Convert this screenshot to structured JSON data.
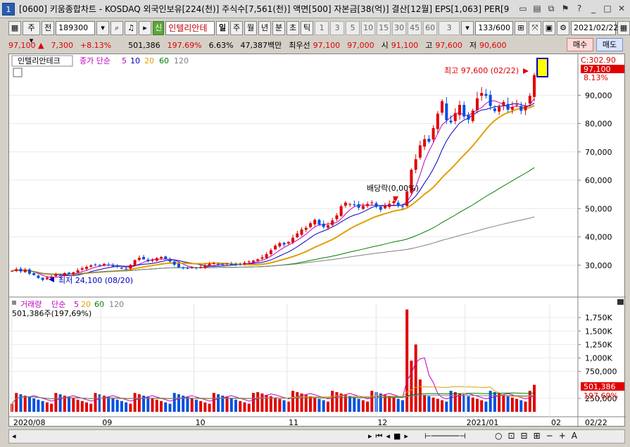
{
  "window": {
    "number": "1",
    "title": "[0600] 키움종합차트 - KOSDAQ 외국인보유[224(천)] 주식수[7,561(천)] 액면[500] 자본금[38(억)] 결산[12월] EPS[1,063] PER[9"
  },
  "toolbar": {
    "period_select": "주",
    "prev_label": "전",
    "code": "189300",
    "sin_badge": "신",
    "stock_name": "인텔리안테",
    "period_tabs": [
      "일",
      "주",
      "월",
      "년",
      "분",
      "초",
      "틱"
    ],
    "active_tab": "일",
    "minute_options": [
      "1",
      "3",
      "5",
      "10",
      "15",
      "30",
      "45",
      "60"
    ],
    "spin_value": "3",
    "count": "133/600",
    "date": "2021/02/22"
  },
  "quote": {
    "price": "97,100",
    "change": "7,300",
    "change_pct": "+8.13%",
    "volume": "501,386",
    "volume_ratio": "197.69%",
    "turnover": "6.63%",
    "amount": "47,387백만",
    "best_label": "최우선",
    "ask": "97,100",
    "bid": "97,000",
    "open_label": "시",
    "open": "91,100",
    "high_label": "고",
    "high": "97,600",
    "low_label": "저",
    "low": "90,600",
    "buy_label": "매수",
    "sell_label": "매도"
  },
  "price_panel": {
    "stock_tag": "인텔리안테크",
    "legend_prefix": "종가 단순",
    "ma": [
      "5",
      "10",
      "20",
      "60",
      "120"
    ],
    "high_annot": "최고 97,600 (02/22)",
    "low_annot": "최저 24,100 (08/20)",
    "dividend_annot": "배당락(0,00%)",
    "axis_top": "C:302.90",
    "axis_price": "97,100",
    "axis_pct": "8.13%",
    "yticks": [
      "90,000",
      "80,000",
      "70,000",
      "60,000",
      "50,000",
      "40,000",
      "30,000"
    ]
  },
  "volume_panel": {
    "legend_title": "거래량",
    "legend_prefix": "단순",
    "ma": [
      "5",
      "20",
      "60",
      "120"
    ],
    "last_value": "501,386주(197,69%)",
    "axis_value": "501,386",
    "axis_pct": "197,69%",
    "yticks": [
      "1,750K",
      "1,500K",
      "1,250K",
      "1,000K",
      "750,000",
      "250,000"
    ]
  },
  "x_axis": {
    "labels": [
      "2020/08",
      "09",
      "10",
      "11",
      "12",
      "2021/01",
      "02"
    ],
    "right_label": "02/22"
  },
  "colors": {
    "up": "#e00000",
    "down": "#0050e0",
    "ma5": "#c000c0",
    "ma10": "#0000c0",
    "ma20": "#e0a000",
    "ma60": "#008000",
    "ma120": "#808080"
  },
  "chart_data": {
    "type": "candlestick",
    "price_range": [
      20000,
      102000
    ],
    "closes": [
      28000,
      28600,
      27800,
      28500,
      27000,
      26500,
      25500,
      24800,
      25600,
      26000,
      26800,
      26500,
      27200,
      26900,
      27500,
      28200,
      28900,
      29400,
      29900,
      30200,
      29800,
      30500,
      30100,
      29600,
      29400,
      28800,
      28600,
      30100,
      31800,
      32600,
      32100,
      31400,
      31900,
      32500,
      32900,
      32200,
      31300,
      30200,
      29300,
      29000,
      28800,
      29300,
      29000,
      29400,
      29900,
      30500,
      30700,
      30400,
      30100,
      30600,
      30300,
      30100,
      30400,
      30900,
      31300,
      31600,
      32100,
      32800,
      33900,
      35300,
      36900,
      37800,
      37300,
      38200,
      39700,
      41200,
      42600,
      43200,
      44800,
      46000,
      44300,
      43500,
      44100,
      45800,
      47600,
      50800,
      52100,
      51600,
      51200,
      50300,
      50900,
      51600,
      52200,
      50600,
      49600,
      50800,
      51700,
      52600,
      50900,
      50600,
      56100,
      63700,
      67400,
      72300,
      74500,
      73600,
      78400,
      83500,
      87900,
      81200,
      80400,
      83700,
      86600,
      82500,
      81400,
      84600,
      88900,
      90800,
      89800,
      86200,
      84400,
      85900,
      87600,
      84900,
      85800,
      86700,
      84500,
      86200,
      89800,
      97100
    ]
  }
}
